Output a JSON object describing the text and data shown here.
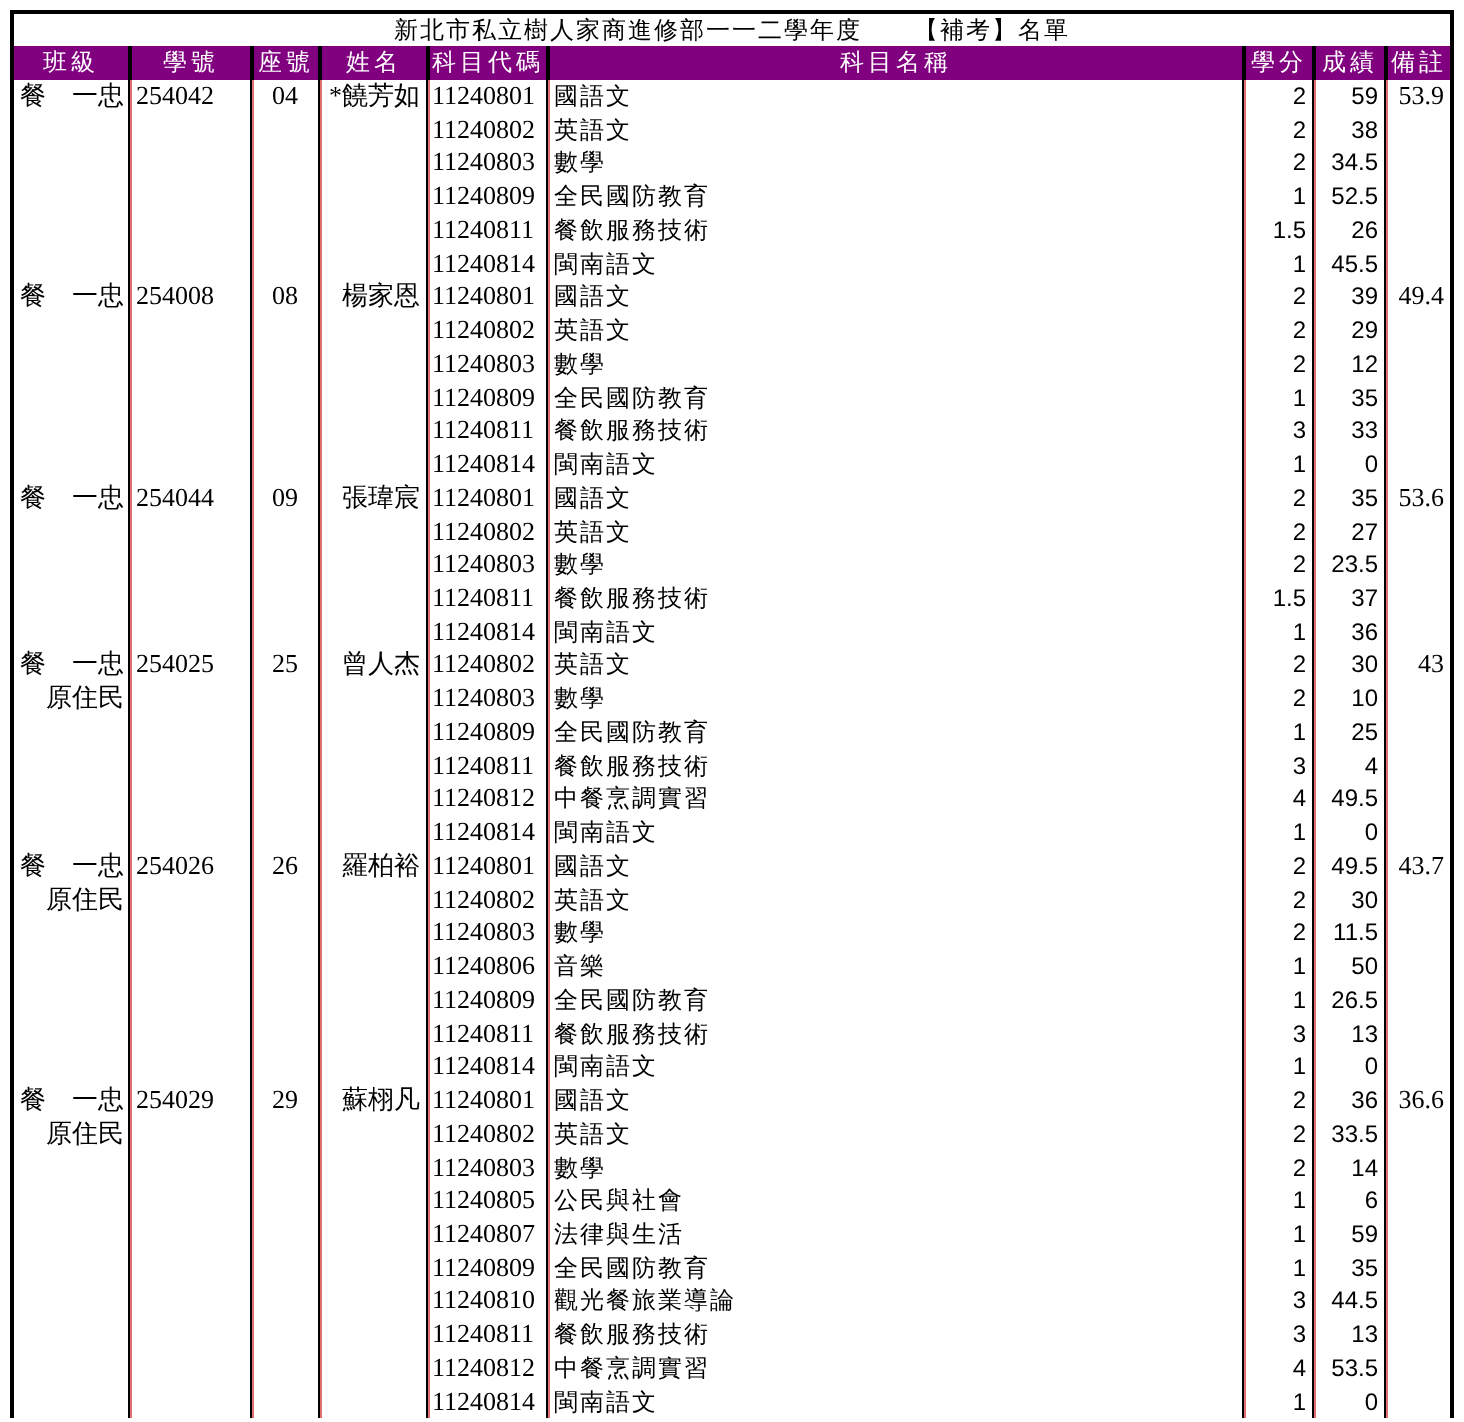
{
  "title": "新北市私立樹人家商進修部一一二學年度　　【補考】名單",
  "columns": [
    "班級",
    "學號",
    "座號",
    "姓名",
    "科目代碼",
    "科目名稱",
    "學分",
    "成績",
    "備註"
  ],
  "students": [
    {
      "class_name": "餐　一忠",
      "student_id": "254042",
      "seat": "04",
      "name": "*饒芳如",
      "note": "53.9",
      "subjects": [
        {
          "code": "11240801",
          "subject": "國語文",
          "credit": "2",
          "score": "59"
        },
        {
          "code": "11240802",
          "subject": "英語文",
          "credit": "2",
          "score": "38"
        },
        {
          "code": "11240803",
          "subject": "數學",
          "credit": "2",
          "score": "34.5"
        },
        {
          "code": "11240809",
          "subject": "全民國防教育",
          "credit": "1",
          "score": "52.5"
        },
        {
          "code": "11240811",
          "subject": "餐飲服務技術",
          "credit": "1.5",
          "score": "26"
        },
        {
          "code": "11240814",
          "subject": "閩南語文",
          "credit": "1",
          "score": "45.5"
        }
      ]
    },
    {
      "class_name": "餐　一忠",
      "student_id": "254008",
      "seat": "08",
      "name": "楊家恩",
      "note": "49.4",
      "subjects": [
        {
          "code": "11240801",
          "subject": "國語文",
          "credit": "2",
          "score": "39"
        },
        {
          "code": "11240802",
          "subject": "英語文",
          "credit": "2",
          "score": "29"
        },
        {
          "code": "11240803",
          "subject": "數學",
          "credit": "2",
          "score": "12"
        },
        {
          "code": "11240809",
          "subject": "全民國防教育",
          "credit": "1",
          "score": "35"
        },
        {
          "code": "11240811",
          "subject": "餐飲服務技術",
          "credit": "3",
          "score": "33"
        },
        {
          "code": "11240814",
          "subject": "閩南語文",
          "credit": "1",
          "score": "0"
        }
      ]
    },
    {
      "class_name": "餐　一忠",
      "student_id": "254044",
      "seat": "09",
      "name": "張瑋宸",
      "note": "53.6",
      "subjects": [
        {
          "code": "11240801",
          "subject": "國語文",
          "credit": "2",
          "score": "35"
        },
        {
          "code": "11240802",
          "subject": "英語文",
          "credit": "2",
          "score": "27"
        },
        {
          "code": "11240803",
          "subject": "數學",
          "credit": "2",
          "score": "23.5"
        },
        {
          "code": "11240811",
          "subject": "餐飲服務技術",
          "credit": "1.5",
          "score": "37"
        },
        {
          "code": "11240814",
          "subject": "閩南語文",
          "credit": "1",
          "score": "36"
        }
      ]
    },
    {
      "class_name": "餐　一忠",
      "identity": "原住民",
      "student_id": "254025",
      "seat": "25",
      "name": "曾人杰",
      "note": "43",
      "subjects": [
        {
          "code": "11240802",
          "subject": "英語文",
          "credit": "2",
          "score": "30"
        },
        {
          "code": "11240803",
          "subject": "數學",
          "credit": "2",
          "score": "10"
        },
        {
          "code": "11240809",
          "subject": "全民國防教育",
          "credit": "1",
          "score": "25"
        },
        {
          "code": "11240811",
          "subject": "餐飲服務技術",
          "credit": "3",
          "score": "4"
        },
        {
          "code": "11240812",
          "subject": "中餐烹調實習",
          "credit": "4",
          "score": "49.5"
        },
        {
          "code": "11240814",
          "subject": "閩南語文",
          "credit": "1",
          "score": "0"
        }
      ]
    },
    {
      "class_name": "餐　一忠",
      "identity": "原住民",
      "student_id": "254026",
      "seat": "26",
      "name": "羅柏裕",
      "note": "43.7",
      "subjects": [
        {
          "code": "11240801",
          "subject": "國語文",
          "credit": "2",
          "score": "49.5"
        },
        {
          "code": "11240802",
          "subject": "英語文",
          "credit": "2",
          "score": "30"
        },
        {
          "code": "11240803",
          "subject": "數學",
          "credit": "2",
          "score": "11.5"
        },
        {
          "code": "11240806",
          "subject": "音樂",
          "credit": "1",
          "score": "50"
        },
        {
          "code": "11240809",
          "subject": "全民國防教育",
          "credit": "1",
          "score": "26.5"
        },
        {
          "code": "11240811",
          "subject": "餐飲服務技術",
          "credit": "3",
          "score": "13"
        },
        {
          "code": "11240814",
          "subject": "閩南語文",
          "credit": "1",
          "score": "0"
        }
      ]
    },
    {
      "class_name": "餐　一忠",
      "identity": "原住民",
      "student_id": "254029",
      "seat": "29",
      "name": "蘇栩凡",
      "note": "36.6",
      "subjects": [
        {
          "code": "11240801",
          "subject": "國語文",
          "credit": "2",
          "score": "36"
        },
        {
          "code": "11240802",
          "subject": "英語文",
          "credit": "2",
          "score": "33.5"
        },
        {
          "code": "11240803",
          "subject": "數學",
          "credit": "2",
          "score": "14"
        },
        {
          "code": "11240805",
          "subject": "公民與社會",
          "credit": "1",
          "score": "6"
        },
        {
          "code": "11240807",
          "subject": "法律與生活",
          "credit": "1",
          "score": "59"
        },
        {
          "code": "11240809",
          "subject": "全民國防教育",
          "credit": "1",
          "score": "35"
        },
        {
          "code": "11240810",
          "subject": "觀光餐旅業導論",
          "credit": "3",
          "score": "44.5"
        },
        {
          "code": "11240811",
          "subject": "餐飲服務技術",
          "credit": "3",
          "score": "13"
        },
        {
          "code": "11240812",
          "subject": "中餐烹調實習",
          "credit": "4",
          "score": "53.5"
        },
        {
          "code": "11240814",
          "subject": "閩南語文",
          "credit": "1",
          "score": "0"
        }
      ]
    }
  ]
}
